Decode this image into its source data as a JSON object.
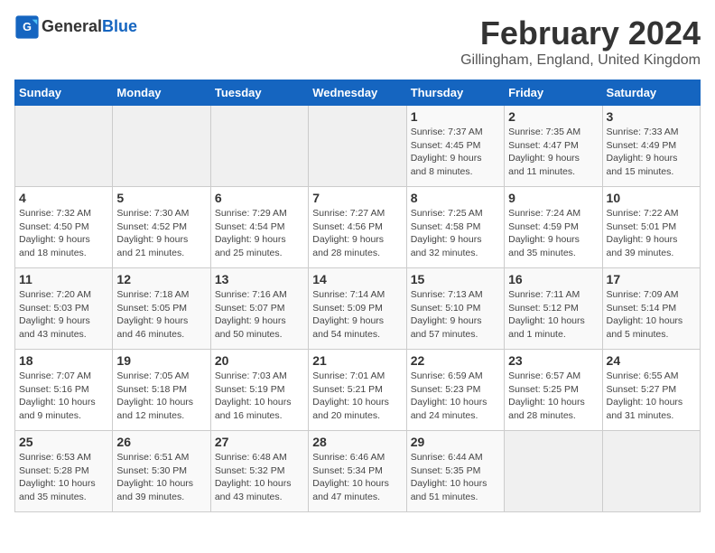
{
  "header": {
    "logo_general": "General",
    "logo_blue": "Blue",
    "title": "February 2024",
    "subtitle": "Gillingham, England, United Kingdom"
  },
  "weekdays": [
    "Sunday",
    "Monday",
    "Tuesday",
    "Wednesday",
    "Thursday",
    "Friday",
    "Saturday"
  ],
  "weeks": [
    [
      {
        "day": "",
        "info": ""
      },
      {
        "day": "",
        "info": ""
      },
      {
        "day": "",
        "info": ""
      },
      {
        "day": "",
        "info": ""
      },
      {
        "day": "1",
        "info": "Sunrise: 7:37 AM\nSunset: 4:45 PM\nDaylight: 9 hours\nand 8 minutes."
      },
      {
        "day": "2",
        "info": "Sunrise: 7:35 AM\nSunset: 4:47 PM\nDaylight: 9 hours\nand 11 minutes."
      },
      {
        "day": "3",
        "info": "Sunrise: 7:33 AM\nSunset: 4:49 PM\nDaylight: 9 hours\nand 15 minutes."
      }
    ],
    [
      {
        "day": "4",
        "info": "Sunrise: 7:32 AM\nSunset: 4:50 PM\nDaylight: 9 hours\nand 18 minutes."
      },
      {
        "day": "5",
        "info": "Sunrise: 7:30 AM\nSunset: 4:52 PM\nDaylight: 9 hours\nand 21 minutes."
      },
      {
        "day": "6",
        "info": "Sunrise: 7:29 AM\nSunset: 4:54 PM\nDaylight: 9 hours\nand 25 minutes."
      },
      {
        "day": "7",
        "info": "Sunrise: 7:27 AM\nSunset: 4:56 PM\nDaylight: 9 hours\nand 28 minutes."
      },
      {
        "day": "8",
        "info": "Sunrise: 7:25 AM\nSunset: 4:58 PM\nDaylight: 9 hours\nand 32 minutes."
      },
      {
        "day": "9",
        "info": "Sunrise: 7:24 AM\nSunset: 4:59 PM\nDaylight: 9 hours\nand 35 minutes."
      },
      {
        "day": "10",
        "info": "Sunrise: 7:22 AM\nSunset: 5:01 PM\nDaylight: 9 hours\nand 39 minutes."
      }
    ],
    [
      {
        "day": "11",
        "info": "Sunrise: 7:20 AM\nSunset: 5:03 PM\nDaylight: 9 hours\nand 43 minutes."
      },
      {
        "day": "12",
        "info": "Sunrise: 7:18 AM\nSunset: 5:05 PM\nDaylight: 9 hours\nand 46 minutes."
      },
      {
        "day": "13",
        "info": "Sunrise: 7:16 AM\nSunset: 5:07 PM\nDaylight: 9 hours\nand 50 minutes."
      },
      {
        "day": "14",
        "info": "Sunrise: 7:14 AM\nSunset: 5:09 PM\nDaylight: 9 hours\nand 54 minutes."
      },
      {
        "day": "15",
        "info": "Sunrise: 7:13 AM\nSunset: 5:10 PM\nDaylight: 9 hours\nand 57 minutes."
      },
      {
        "day": "16",
        "info": "Sunrise: 7:11 AM\nSunset: 5:12 PM\nDaylight: 10 hours\nand 1 minute."
      },
      {
        "day": "17",
        "info": "Sunrise: 7:09 AM\nSunset: 5:14 PM\nDaylight: 10 hours\nand 5 minutes."
      }
    ],
    [
      {
        "day": "18",
        "info": "Sunrise: 7:07 AM\nSunset: 5:16 PM\nDaylight: 10 hours\nand 9 minutes."
      },
      {
        "day": "19",
        "info": "Sunrise: 7:05 AM\nSunset: 5:18 PM\nDaylight: 10 hours\nand 12 minutes."
      },
      {
        "day": "20",
        "info": "Sunrise: 7:03 AM\nSunset: 5:19 PM\nDaylight: 10 hours\nand 16 minutes."
      },
      {
        "day": "21",
        "info": "Sunrise: 7:01 AM\nSunset: 5:21 PM\nDaylight: 10 hours\nand 20 minutes."
      },
      {
        "day": "22",
        "info": "Sunrise: 6:59 AM\nSunset: 5:23 PM\nDaylight: 10 hours\nand 24 minutes."
      },
      {
        "day": "23",
        "info": "Sunrise: 6:57 AM\nSunset: 5:25 PM\nDaylight: 10 hours\nand 28 minutes."
      },
      {
        "day": "24",
        "info": "Sunrise: 6:55 AM\nSunset: 5:27 PM\nDaylight: 10 hours\nand 31 minutes."
      }
    ],
    [
      {
        "day": "25",
        "info": "Sunrise: 6:53 AM\nSunset: 5:28 PM\nDaylight: 10 hours\nand 35 minutes."
      },
      {
        "day": "26",
        "info": "Sunrise: 6:51 AM\nSunset: 5:30 PM\nDaylight: 10 hours\nand 39 minutes."
      },
      {
        "day": "27",
        "info": "Sunrise: 6:48 AM\nSunset: 5:32 PM\nDaylight: 10 hours\nand 43 minutes."
      },
      {
        "day": "28",
        "info": "Sunrise: 6:46 AM\nSunset: 5:34 PM\nDaylight: 10 hours\nand 47 minutes."
      },
      {
        "day": "29",
        "info": "Sunrise: 6:44 AM\nSunset: 5:35 PM\nDaylight: 10 hours\nand 51 minutes."
      },
      {
        "day": "",
        "info": ""
      },
      {
        "day": "",
        "info": ""
      }
    ]
  ]
}
